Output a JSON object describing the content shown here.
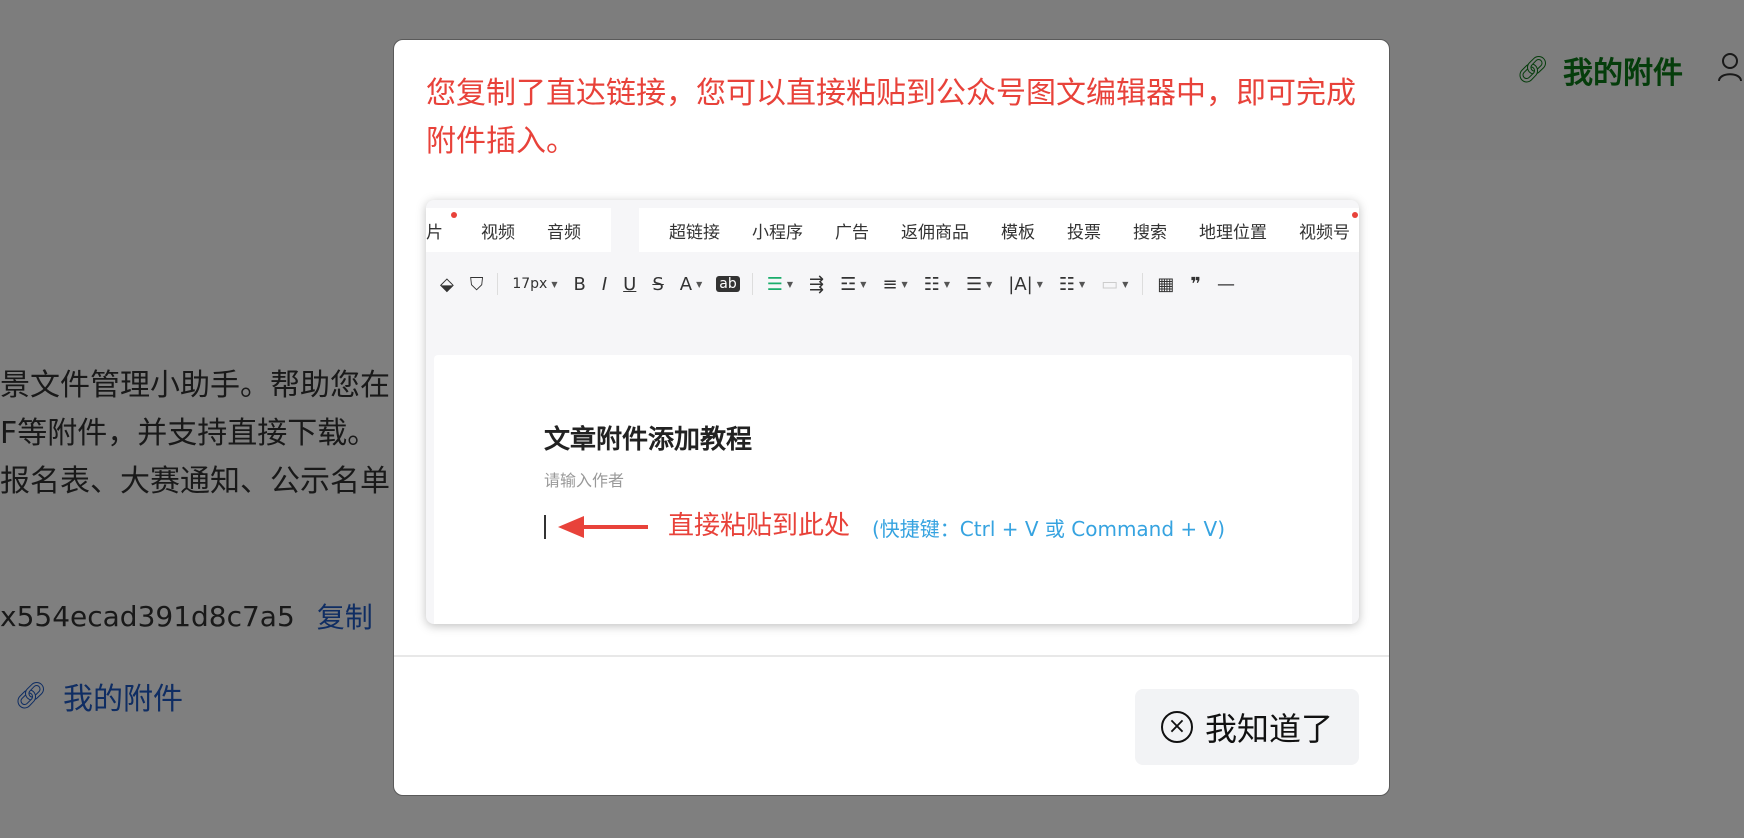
{
  "background": {
    "top_link_label": "我的附件",
    "text_lines": [
      "景文件管理小助手。帮助您在",
      "F等附件，并支持直接下载。",
      "报名表、大赛通知、公示名单"
    ],
    "code_text": "x554ecad391d8c7a5",
    "copy_label": "复制",
    "attach_label": "我的附件"
  },
  "modal": {
    "message": "您复制了直达链接，您可以直接粘贴到公众号图文编辑器中，即可完成附件插入。",
    "ok_button_label": "我知道了"
  },
  "editor_illustration": {
    "menu_items_group1": [
      "片",
      "视频",
      "音频"
    ],
    "menu_items_group2": [
      "超链接",
      "小程序",
      "广告",
      "返佣商品",
      "模板",
      "投票",
      "搜索",
      "地理位置",
      "视频号",
      "···"
    ],
    "toolbar_font_size": "17px",
    "toolbar_labels": {
      "bold": "B",
      "italic": "I",
      "underline": "U",
      "strike": "S",
      "font_color": "A",
      "bg_color": "ab",
      "letter": "|A|"
    },
    "article_title": "文章附件添加教程",
    "author_placeholder": "请输入作者",
    "paste_hint": "直接粘贴到此处",
    "paste_shortcut": "(快捷键：Ctrl + V  或 Command + V)"
  },
  "colors": {
    "message_red": "#e8423a",
    "shortcut_blue": "#36a3e0",
    "link_green": "#0a7a17",
    "link_blue": "#1f5bc6",
    "overlay": "#808080"
  }
}
